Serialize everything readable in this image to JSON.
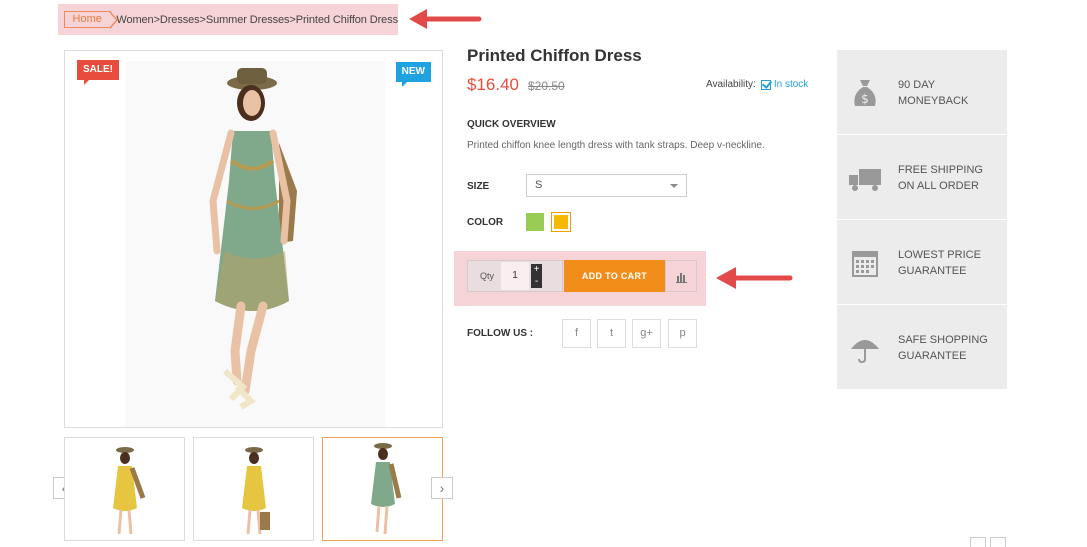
{
  "breadcrumb": {
    "home": "Home",
    "trail": "Women>Dresses>Summer Dresses>Printed Chiffon Dress"
  },
  "badges": {
    "sale": "SALE!",
    "new": "NEW"
  },
  "gallery": {
    "prev_icon": "chevron-left-icon",
    "next_icon": "chevron-right-icon",
    "prev_glyph": "‹",
    "next_glyph": "›",
    "active_thumb": 3
  },
  "product": {
    "title": "Printed Chiffon Dress",
    "price": "$16.40",
    "old_price": "$20.50",
    "availability_label": "Availability:",
    "availability_value": "In stock",
    "quick_overview_heading": "QUICK OVERVIEW",
    "quick_overview_text": "Printed chiffon knee length dress with tank straps. Deep v-neckline.",
    "size_label": "SIZE",
    "size_selected": "S",
    "color_label": "COLOR",
    "colors": [
      "#99cc55",
      "#f6b800"
    ],
    "qty_label": "Qty",
    "qty_value": "1",
    "qty_plus": "+",
    "qty_minus": "-",
    "add_to_cart": "ADD TO CART",
    "follow_label": "FOLLOW US :",
    "social": [
      {
        "icon": "facebook-icon",
        "glyph": "f"
      },
      {
        "icon": "twitter-icon",
        "glyph": "t"
      },
      {
        "icon": "google-plus-icon",
        "glyph": "g+"
      },
      {
        "icon": "pinterest-icon",
        "glyph": "p"
      }
    ]
  },
  "features": [
    {
      "line1": "90 DAY",
      "line2": "MONEYBACK",
      "icon": "money-bag-icon"
    },
    {
      "line1": "FREE SHIPPING",
      "line2": "ON ALL ORDER",
      "icon": "truck-icon"
    },
    {
      "line1": "LOWEST PRICE",
      "line2": "GUARANTEE",
      "icon": "calendar-icon"
    },
    {
      "line1": "SAFE SHOPPING",
      "line2": "GUARANTEE",
      "icon": "umbrella-icon"
    }
  ],
  "colors": {
    "accent_orange": "#f38d1a",
    "price_red": "#e84c3d",
    "link_blue": "#1fa3e0",
    "highlight_pink": "#f6d3d6",
    "annotation_arrow": "#e24a4a"
  }
}
